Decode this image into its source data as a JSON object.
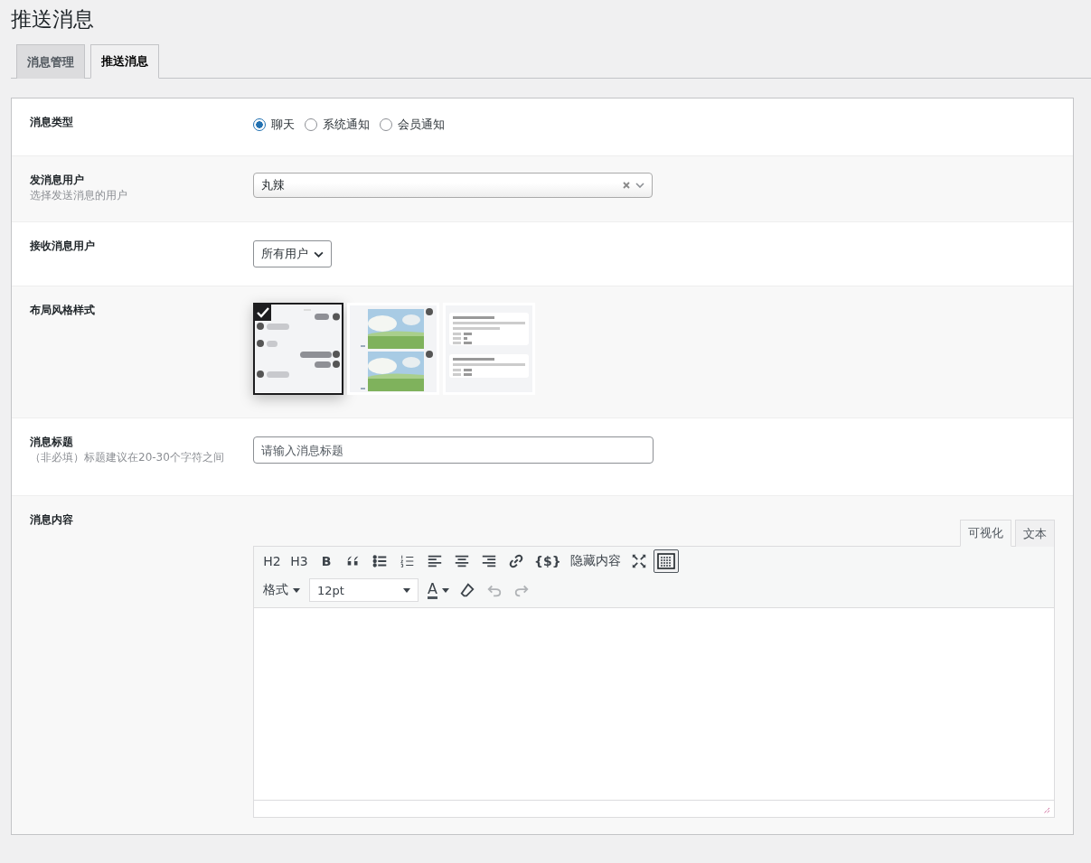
{
  "page": {
    "title": "推送消息"
  },
  "tabs": [
    {
      "label": "消息管理",
      "selected": false
    },
    {
      "label": "推送消息",
      "selected": true
    }
  ],
  "form": {
    "rows": [
      {
        "kind": "radio",
        "label": "消息类型",
        "options": [
          {
            "label": "聊天",
            "selected": true
          },
          {
            "label": "系统通知",
            "selected": false
          },
          {
            "label": "会员通知",
            "selected": false
          }
        ]
      },
      {
        "kind": "combo",
        "label": "发消息用户",
        "hint": "选择发送消息的用户",
        "value": "丸辣"
      },
      {
        "kind": "select",
        "label": "接收消息用户",
        "value": "所有用户"
      },
      {
        "kind": "layouts",
        "label": "布局风格样式",
        "options": [
          {
            "kind": "chat",
            "selected": true
          },
          {
            "kind": "image",
            "selected": false
          },
          {
            "kind": "card",
            "selected": false
          }
        ]
      },
      {
        "kind": "text",
        "label": "消息标题",
        "hint": "（非必填）标题建议在20-30个字符之间",
        "placeholder": "请输入消息标题"
      },
      {
        "kind": "editor",
        "label": "消息内容"
      }
    ]
  },
  "editor": {
    "modes": [
      {
        "label": "可视化",
        "selected": true
      },
      {
        "label": "文本",
        "selected": false
      }
    ],
    "toolbar1": [
      {
        "kind": "text",
        "label": "H2"
      },
      {
        "kind": "text",
        "label": "H3"
      },
      {
        "kind": "text",
        "label": "B",
        "bold": true
      },
      {
        "kind": "quote"
      },
      {
        "kind": "bullets"
      },
      {
        "kind": "numbers"
      },
      {
        "kind": "align-left"
      },
      {
        "kind": "align-center"
      },
      {
        "kind": "align-right"
      },
      {
        "kind": "link"
      },
      {
        "kind": "text",
        "label": "{$}",
        "bold": true
      },
      {
        "kind": "text",
        "label": "隐藏内容"
      },
      {
        "kind": "fullscreen"
      },
      {
        "kind": "keyboard",
        "pressed": true
      }
    ],
    "toolbar2": [
      {
        "kind": "menu",
        "label": "格式"
      },
      {
        "kind": "size",
        "value": "12pt"
      },
      {
        "kind": "color",
        "label": "A"
      },
      {
        "kind": "eraser"
      },
      {
        "kind": "undo",
        "disabled": true
      },
      {
        "kind": "redo",
        "disabled": true
      }
    ]
  }
}
